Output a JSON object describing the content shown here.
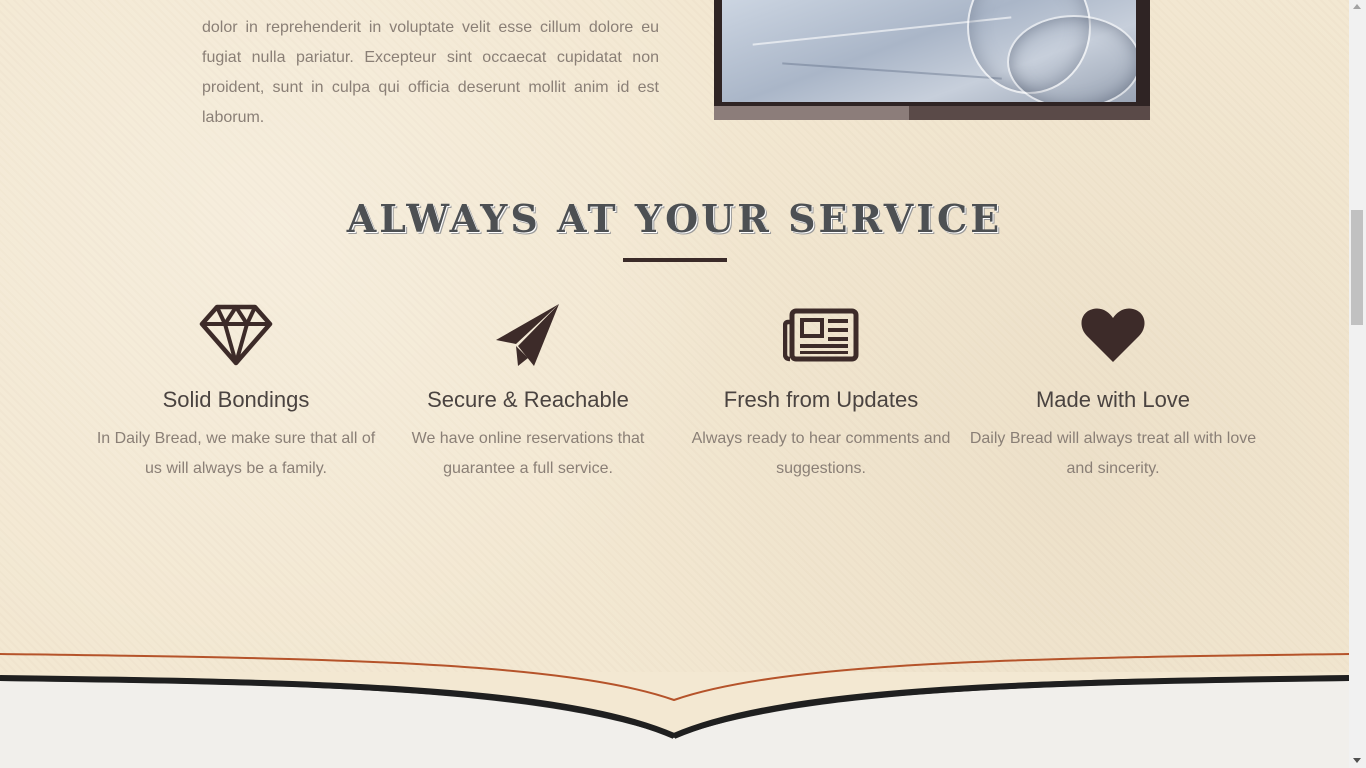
{
  "about": {
    "text": "dolor in reprehenderit in voluptate velit esse cillum dolore eu fugiat nulla pariatur. Excepteur sint occaecat cupidatat non proident, sunt in culpa qui officia deserunt mollit anim id est laborum."
  },
  "services": {
    "title": "ALWAYS AT YOUR SERVICE",
    "items": [
      {
        "icon": "diamond-icon",
        "title": "Solid Bondings",
        "text": "In Daily Bread, we make sure that all of us will always be a family."
      },
      {
        "icon": "paper-plane-icon",
        "title": "Secure & Reachable",
        "text": "We have online reservations that guarantee a full service."
      },
      {
        "icon": "newspaper-icon",
        "title": "Fresh from Updates",
        "text": "Always ready to hear comments and suggestions."
      },
      {
        "icon": "heart-icon",
        "title": "Made with Love",
        "text": "Daily Bread will always treat all with love and sincerity."
      }
    ]
  },
  "colors": {
    "background": "#f3e8d2",
    "icon": "#3d2b29",
    "heading": "#4d5053",
    "body_text": "#8a7f76",
    "accent_line": "#b5532a"
  }
}
